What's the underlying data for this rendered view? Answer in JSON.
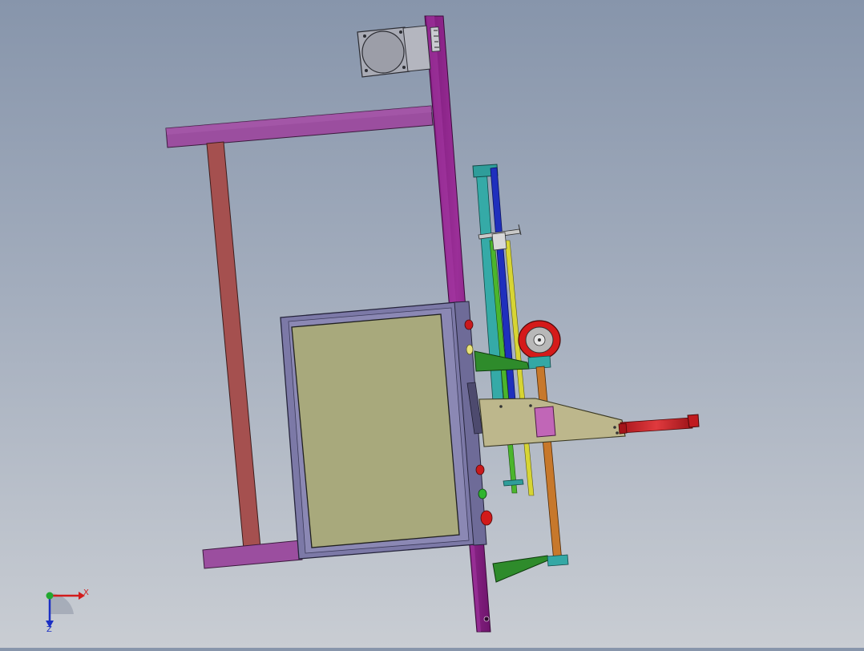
{
  "viewport": {
    "background_top": "#8795ab",
    "background_bottom": "#c9cdd3"
  },
  "model": {
    "colors": {
      "frame_purple": "#9a4c9e",
      "column_magenta": "#8c1f8a",
      "leg_red": "#a3504e",
      "box_body": "#7b78a6",
      "box_face": "#a8a97c",
      "rod_teal": "#33a9a6",
      "rod_blue": "#1f2fbd",
      "rod_green": "#4bb52d",
      "rod_yellow": "#d8d632",
      "rod_orange": "#c7782b",
      "plate_tan": "#bdb78c",
      "bracket_green": "#2e8b2b",
      "cylinder_red": "#c7191e",
      "wheel_red": "#d51a1a",
      "block_pink": "#c166b7",
      "motor_gray": "#a7a9b3"
    }
  },
  "triad": {
    "x_label": "X",
    "z_label": "Z",
    "x_color": "#d21c1c",
    "z_color": "#1b2fc4",
    "y_color": "#22a830"
  }
}
